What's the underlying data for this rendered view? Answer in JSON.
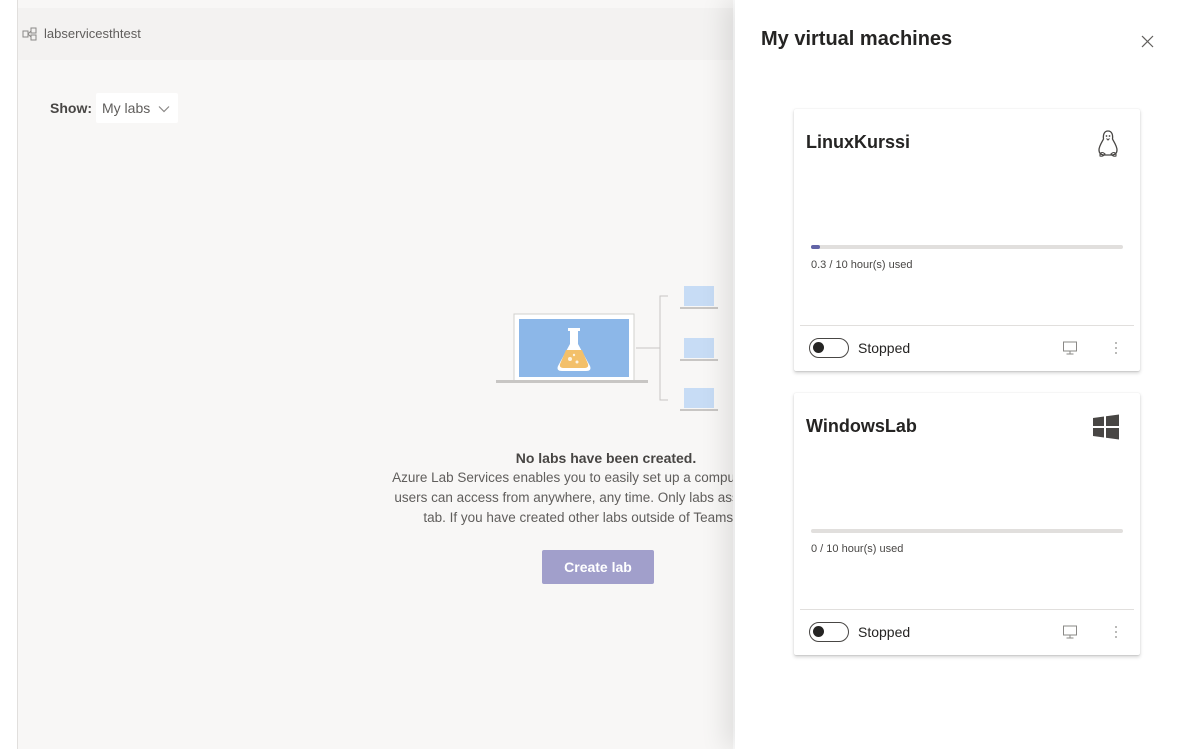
{
  "team": {
    "name": "labservicesthtest",
    "icon": "team-icon"
  },
  "filter": {
    "label": "Show:",
    "value": "My labs"
  },
  "empty_state": {
    "title": "No labs have been created.",
    "lines": [
      "Azure Lab Services enables you to easily set up a computer lab in the c",
      "users can access from anywhere, any time. Only labs associated with t",
      "tab. If you have created other labs outside of Teams, they will"
    ],
    "button_label": "Create lab"
  },
  "panel": {
    "title": "My virtual machines",
    "vms": [
      {
        "name": "LinuxKurssi",
        "os_icon": "linux-penguin-icon",
        "usage_text": "0.3 / 10 hour(s) used",
        "used_fraction": 0.03,
        "status": "Stopped"
      },
      {
        "name": "WindowsLab",
        "os_icon": "windows-logo-icon",
        "usage_text": "0 / 10 hour(s) used",
        "used_fraction": 0.0,
        "status": "Stopped"
      }
    ]
  },
  "colors": {
    "accent": "#6264a7",
    "button_disabled": "#a19fcb",
    "illustration_screen": "#8cb7e8"
  }
}
